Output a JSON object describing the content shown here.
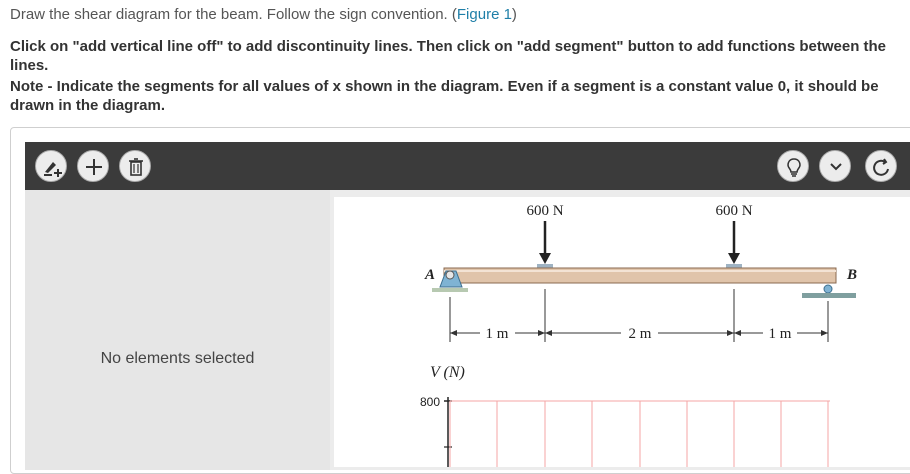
{
  "question": {
    "line1_prefix": "Draw the shear diagram for the beam. Follow the sign convention. (",
    "figure_link": "Figure 1",
    "line1_suffix": ")",
    "instruction": "Click on \"add vertical line off\" to add discontinuity lines. Then click on \"add segment\" button to add functions between the lines.",
    "note": "Note - Indicate the segments for all values of x shown in the diagram. Even if a segment is a constant value 0, it should be drawn in the diagram."
  },
  "toolbar": {
    "left_icons": [
      "add-vertical-line-icon",
      "add-segment-icon",
      "delete-icon"
    ],
    "right_icons": [
      "hint-bulb-icon",
      "chevron-down-icon",
      "redo-icon"
    ]
  },
  "sidebar": {
    "status": "No elements selected"
  },
  "figure": {
    "load1": "600 N",
    "load2": "600 N",
    "support_a": "A",
    "support_b": "B",
    "dim1": "1 m",
    "dim2": "2 m",
    "dim3": "1 m",
    "v_axis_label": "V (N)",
    "v_tick": "800"
  },
  "colors": {
    "toolbar_bg": "#3b3b3b",
    "beam": "#e0c4aa",
    "grid": "#f4a6a6",
    "link": "#1f7fa8"
  }
}
